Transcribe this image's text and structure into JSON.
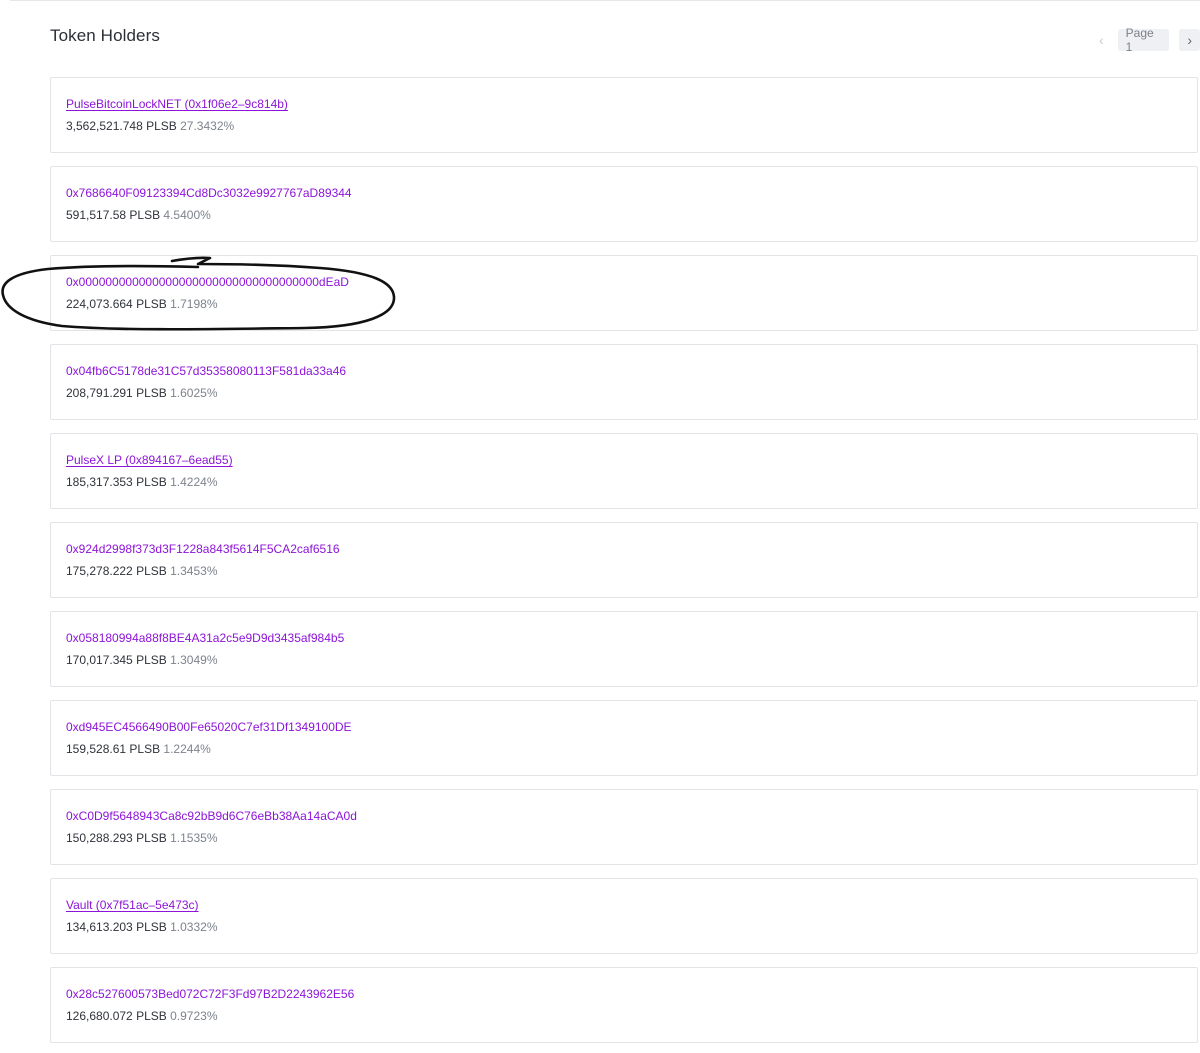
{
  "header": {
    "title": "Token Holders"
  },
  "pagination": {
    "prev_icon": "‹",
    "page_label": "Page 1",
    "next_icon": "›"
  },
  "holders": [
    {
      "address": "PulseBitcoinLockNET (0x1f06e2–9c814b)",
      "amount": "3,562,521.748 PLSB",
      "percent": "27.3432%",
      "named": true
    },
    {
      "address": "0x7686640F09123394Cd8Dc3032e9927767aD89344",
      "amount": "591,517.58 PLSB",
      "percent": "4.5400%",
      "named": false
    },
    {
      "address": "0x000000000000000000000000000000000000dEaD",
      "amount": "224,073.664 PLSB",
      "percent": "1.7198%",
      "named": false
    },
    {
      "address": "0x04fb6C5178de31C57d35358080113F581da33a46",
      "amount": "208,791.291 PLSB",
      "percent": "1.6025%",
      "named": false
    },
    {
      "address": "PulseX LP (0x894167–6ead55)",
      "amount": "185,317.353 PLSB",
      "percent": "1.4224%",
      "named": true
    },
    {
      "address": "0x924d2998f373d3F1228a843f5614F5CA2caf6516",
      "amount": "175,278.222 PLSB",
      "percent": "1.3453%",
      "named": false
    },
    {
      "address": "0x058180994a88f8BE4A31a2c5e9D9d3435af984b5",
      "amount": "170,017.345 PLSB",
      "percent": "1.3049%",
      "named": false
    },
    {
      "address": "0xd945EC4566490B00Fe65020C7ef31Df1349100DE",
      "amount": "159,528.61 PLSB",
      "percent": "1.2244%",
      "named": false
    },
    {
      "address": "0xC0D9f5648943Ca8c92bB9d6C76eBb38Aa14aCA0d",
      "amount": "150,288.293 PLSB",
      "percent": "1.1535%",
      "named": false
    },
    {
      "address": "Vault (0x7f51ac–5e473c)",
      "amount": "134,613.203 PLSB",
      "percent": "1.0332%",
      "named": true
    },
    {
      "address": "0x28c527600573Bed072C72F3Fd97B2D2243962E56",
      "amount": "126,680.072 PLSB",
      "percent": "0.9723%",
      "named": false
    }
  ],
  "colors": {
    "link": "#8d14d8",
    "annotation_ink": "#111111"
  },
  "icons": {
    "prev": "chevron-left-icon",
    "next": "chevron-right-icon"
  }
}
